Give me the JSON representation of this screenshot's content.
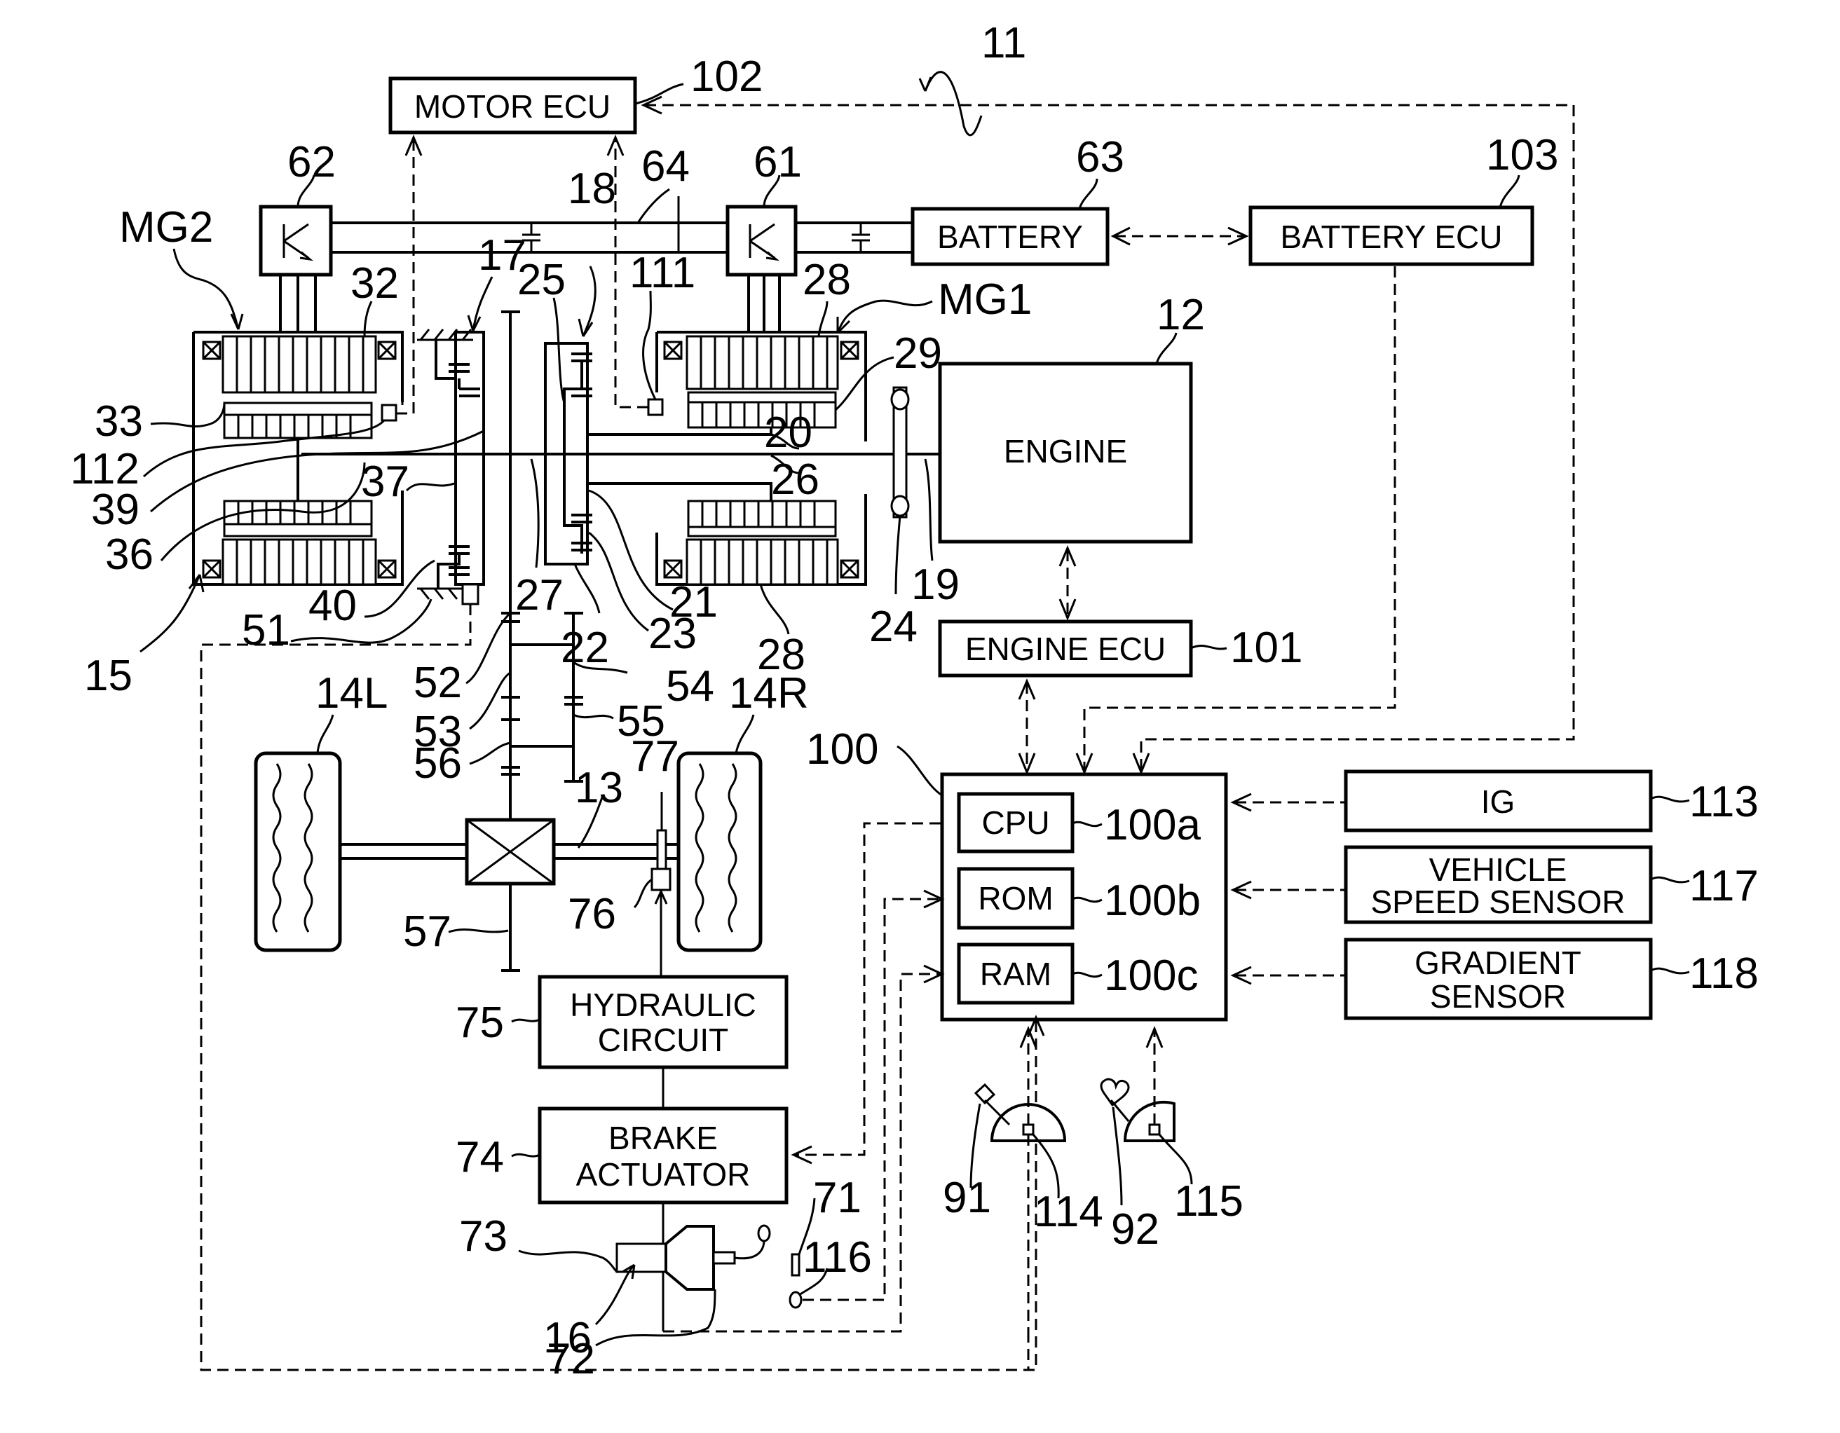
{
  "figure": {
    "system_ref": "11",
    "blocks": {
      "motor_ecu": {
        "label": "MOTOR ECU",
        "ref": "102"
      },
      "battery": {
        "label": "BATTERY",
        "ref": "63"
      },
      "battery_ecu": {
        "label": "BATTERY ECU",
        "ref": "103"
      },
      "engine": {
        "label": "ENGINE",
        "ref": "12"
      },
      "engine_ecu": {
        "label": "ENGINE ECU",
        "ref": "101"
      },
      "main_ecu": {
        "ref": "100"
      },
      "cpu": {
        "label": "CPU",
        "ref": "100a"
      },
      "rom": {
        "label": "ROM",
        "ref": "100b"
      },
      "ram": {
        "label": "RAM",
        "ref": "100c"
      },
      "ig": {
        "label": "IG",
        "ref": "113"
      },
      "vehicle_speed_sensor": {
        "label_line1": "VEHICLE",
        "label_line2": "SPEED SENSOR",
        "ref": "117"
      },
      "gradient_sensor": {
        "label_line1": "GRADIENT",
        "label_line2": "SENSOR",
        "ref": "118"
      },
      "hydraulic_circuit": {
        "label_line1": "HYDRAULIC",
        "label_line2": "CIRCUIT",
        "ref": "75"
      },
      "brake_actuator": {
        "label_line1": "BRAKE",
        "label_line2": "ACTUATOR",
        "ref": "74"
      }
    },
    "refs": {
      "inverter_mg2": "62",
      "inverter_mg1": "61",
      "power_line": "64",
      "mg2": "MG2",
      "mg1": "MG1",
      "r17": "17",
      "r18": "18",
      "r25": "25",
      "r111": "111",
      "r28a": "28",
      "r29": "29",
      "r32": "32",
      "r33": "33",
      "r112": "112",
      "r39": "39",
      "r36": "36",
      "r37": "37",
      "r20": "20",
      "r26": "26",
      "r19": "19",
      "r24": "24",
      "r21": "21",
      "r28b": "28",
      "r23": "23",
      "r22": "22",
      "r27": "27",
      "r40": "40",
      "r51": "51",
      "r15": "15",
      "r52": "52",
      "r53": "53",
      "r54": "54",
      "r55": "55",
      "r56": "56",
      "r14L": "14L",
      "r14R": "14R",
      "r77": "77",
      "r13": "13",
      "r76": "76",
      "r57": "57",
      "r73": "73",
      "r71": "71",
      "r116": "116",
      "r16": "16",
      "r72": "72",
      "r91": "91",
      "r114": "114",
      "r92": "92",
      "r115": "115"
    }
  }
}
